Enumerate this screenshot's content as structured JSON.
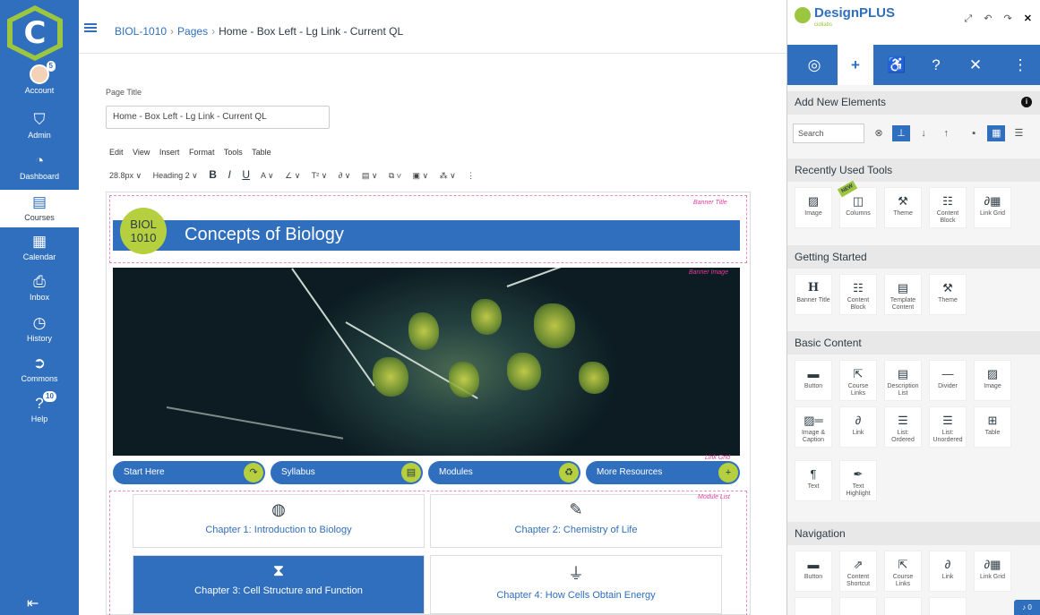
{
  "global_nav": {
    "logo_letter": "C",
    "items": [
      {
        "label": "Account",
        "icon": "user-avatar-icon",
        "badge": "5"
      },
      {
        "label": "Admin",
        "icon": "shield-icon"
      },
      {
        "label": "Dashboard",
        "icon": "speedometer-icon"
      },
      {
        "label": "Courses",
        "icon": "book-icon"
      },
      {
        "label": "Calendar",
        "icon": "calendar-icon"
      },
      {
        "label": "Inbox",
        "icon": "inbox-icon"
      },
      {
        "label": "History",
        "icon": "clock-icon"
      },
      {
        "label": "Commons",
        "icon": "commons-arrow-icon"
      },
      {
        "label": "Help",
        "icon": "help-icon",
        "badge": "10"
      }
    ]
  },
  "breadcrumb": {
    "course": "BIOL-1010",
    "section": "Pages",
    "page": "Home - Box Left - Lg Link - Current QL"
  },
  "editor": {
    "page_title_label": "Page Title",
    "page_title_value": "Home - Box Left - Lg Link - Current QL",
    "menu": [
      "Edit",
      "View",
      "Insert",
      "Format",
      "Tools",
      "Table"
    ],
    "toolbar": {
      "font_size": "28.8px ∨",
      "block_format": "Heading 2 ∨",
      "bold": "B",
      "italic": "I",
      "underline": "U",
      "text_color": "A ∨",
      "highlight": "∠ ∨",
      "superscript": "T² ∨",
      "link": "∂ ∨",
      "image": "▤ ∨",
      "media": "⧉ ∨",
      "document": "▣ ∨",
      "apps": "⁂ ∨",
      "more": "⋮"
    }
  },
  "content": {
    "banner_label": "Banner Title",
    "banner_image_label": "Banner Image",
    "link_grid_label": "Link Grid",
    "module_list_label": "Module List",
    "course_code_line1": "BIOL",
    "course_code_line2": "1010",
    "banner_title": "Concepts of Biology",
    "links": [
      {
        "label": "Start Here",
        "icon": "arrow-forward-icon"
      },
      {
        "label": "Syllabus",
        "icon": "document-icon"
      },
      {
        "label": "Modules",
        "icon": "recycle-icon"
      },
      {
        "label": "More Resources",
        "icon": "plus-icon"
      }
    ],
    "modules": [
      {
        "label": "Chapter 1: Introduction to Biology",
        "icon": "globe-icon",
        "selected": false
      },
      {
        "label": "Chapter 2: Chemistry of Life",
        "icon": "eyedropper-icon",
        "selected": false
      },
      {
        "label": "Chapter 3: Cell Structure and Function",
        "icon": "hourglass-icon",
        "selected": true
      },
      {
        "label": "Chapter 4: How Cells Obtain Energy",
        "icon": "plug-icon",
        "selected": false
      }
    ]
  },
  "designplus": {
    "brand": "DesignPLUS",
    "brand_sub": "cidilabs",
    "panel_title": "Add New Elements",
    "search_placeholder": "Search",
    "sections": {
      "recent": {
        "title": "Recently Used Tools",
        "tiles": [
          "Image",
          "Columns",
          "Theme",
          "Content Block",
          "Link Grid"
        ]
      },
      "getting_started": {
        "title": "Getting Started",
        "tiles": [
          "Banner Title",
          "Content Block",
          "Template Content",
          "Theme"
        ]
      },
      "basic": {
        "title": "Basic Content",
        "tiles": [
          "Button",
          "Course Links",
          "Description List",
          "Divider",
          "Image",
          "Image & Caption",
          "Link",
          "List: Ordered",
          "List: Unordered",
          "Table",
          "Text",
          "Text Highlight"
        ]
      },
      "navigation": {
        "title": "Navigation",
        "tiles": [
          "Button",
          "Content Shortcut",
          "Course Links",
          "Link",
          "Link Grid"
        ]
      }
    },
    "new_tag": "NEW",
    "notification": "0"
  },
  "colors": {
    "brand_blue": "#2f6fbd",
    "accent_green": "#b6cf3f",
    "highlight_pink": "#e23d9c"
  }
}
